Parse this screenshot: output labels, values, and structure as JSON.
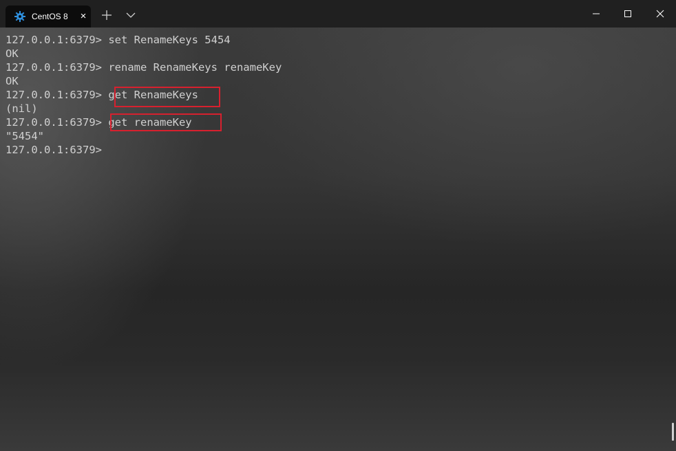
{
  "tab": {
    "title": "CentOS 8",
    "icon": "centos-gear-icon",
    "close_glyph": "×"
  },
  "toolbar": {
    "new_tab_icon": "plus-icon",
    "dropdown_icon": "chevron-down-icon"
  },
  "window_controls": [
    "minimize-icon",
    "maximize-icon",
    "close-icon"
  ],
  "colors": {
    "highlight": "#d8202e",
    "terminal_text": "#d0d0d0",
    "tab_icon": "#2f8fdd"
  },
  "terminal": {
    "lines": [
      {
        "prompt": "127.0.0.1:6379>",
        "command": "set RenameKeys 5454"
      },
      {
        "output": "OK"
      },
      {
        "prompt": "127.0.0.1:6379>",
        "command": "rename RenameKeys renameKey"
      },
      {
        "output": "OK"
      },
      {
        "prompt": "127.0.0.1:6379>",
        "command": "get RenameKeys",
        "highlighted": true
      },
      {
        "output": "(nil)"
      },
      {
        "prompt": "127.0.0.1:6379>",
        "command": "get renameKey",
        "highlighted": true
      },
      {
        "output": "\"5454\""
      },
      {
        "prompt": "127.0.0.1:6379>",
        "command": ""
      }
    ]
  }
}
